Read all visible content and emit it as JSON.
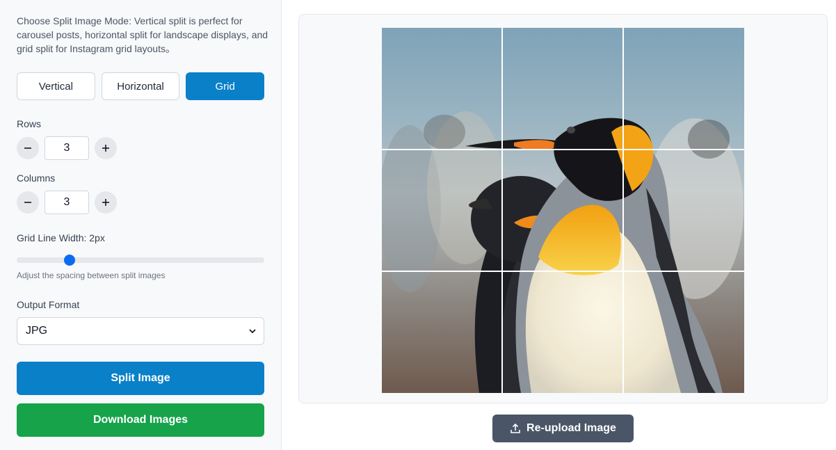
{
  "sidebar": {
    "description": "Choose Split Image Mode: Vertical split is perfect for carousel posts, horizontal split for landscape displays, and grid split for Instagram grid layouts。",
    "modes": [
      {
        "label": "Vertical",
        "active": false
      },
      {
        "label": "Horizontal",
        "active": false
      },
      {
        "label": "Grid",
        "active": true
      }
    ],
    "rows_label": "Rows",
    "rows_value": "3",
    "columns_label": "Columns",
    "columns_value": "3",
    "grid_line_label": "Grid Line Width: 2px",
    "grid_line_width": 2,
    "slider_hint": "Adjust the spacing between split images",
    "output_format_label": "Output Format",
    "output_format_value": "JPG",
    "split_button": "Split Image",
    "download_button": "Download Images"
  },
  "preview": {
    "grid_rows": 3,
    "grid_columns": 3,
    "reupload_button": "Re-upload Image"
  },
  "colors": {
    "primary": "#0a80c8",
    "success": "#16a34a",
    "secondary": "#4a5568"
  }
}
